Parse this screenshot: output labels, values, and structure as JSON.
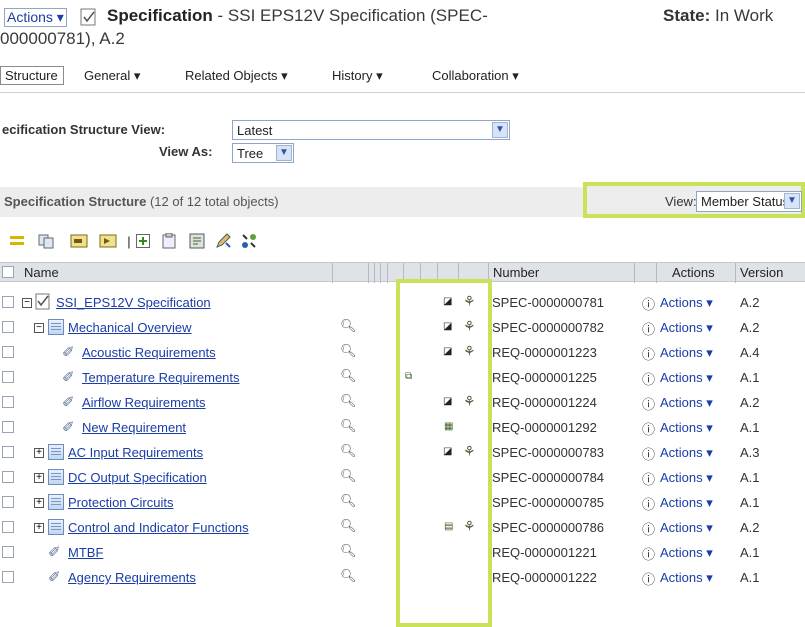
{
  "header": {
    "actions_label": "Actions",
    "object_type": "Specification",
    "title_rest": " - SSI EPS12V Specification (SPEC-",
    "title_line2": "000000781), A.2",
    "state_label": "State:",
    "state_value": "In Work"
  },
  "tabs": [
    {
      "label": "Structure"
    },
    {
      "label": "General"
    },
    {
      "label": "Related Objects"
    },
    {
      "label": "History"
    },
    {
      "label": "Collaboration"
    }
  ],
  "view": {
    "structure_view_label": "ecification Structure View:",
    "structure_view_value": "Latest",
    "view_as_label": "View As:",
    "view_as_value": "Tree"
  },
  "section": {
    "title": "Specification Structure",
    "count": "(12 of 12 total objects)",
    "view_label": "View:",
    "view_value": "Member Status"
  },
  "table": {
    "columns": [
      "Name",
      "Number",
      "Actions",
      "Version"
    ],
    "rows": [
      {
        "name": "SSI_EPS12V Specification",
        "number": "SPEC-0000000781",
        "actions": "Actions",
        "version": "A.2"
      },
      {
        "name": "Mechanical Overview",
        "number": "SPEC-0000000782",
        "actions": "Actions",
        "version": "A.2"
      },
      {
        "name": "Acoustic Requirements",
        "number": "REQ-0000001223",
        "actions": "Actions",
        "version": "A.4"
      },
      {
        "name": "Temperature Requirements",
        "number": "REQ-0000001225",
        "actions": "Actions",
        "version": "A.1"
      },
      {
        "name": "Airflow Requirements",
        "number": "REQ-0000001224",
        "actions": "Actions",
        "version": "A.2"
      },
      {
        "name": "New Requirement",
        "number": "REQ-0000001292",
        "actions": "Actions",
        "version": "A.1"
      },
      {
        "name": "AC Input Requirements",
        "number": "SPEC-0000000783",
        "actions": "Actions",
        "version": "A.3"
      },
      {
        "name": "DC Output Specification",
        "number": "SPEC-0000000784",
        "actions": "Actions",
        "version": "A.1"
      },
      {
        "name": "Protection Circuits",
        "number": "SPEC-0000000785",
        "actions": "Actions",
        "version": "A.1"
      },
      {
        "name": "Control and Indicator Functions",
        "number": "SPEC-0000000786",
        "actions": "Actions",
        "version": "A.2"
      },
      {
        "name": "MTBF",
        "number": "REQ-0000001221",
        "actions": "Actions",
        "version": "A.1"
      },
      {
        "name": "Agency Requirements",
        "number": "REQ-0000001222",
        "actions": "Actions",
        "version": "A.1"
      }
    ]
  },
  "colors": {
    "highlight": "#c8e25a",
    "link": "#1a3da8",
    "header_bg": "#ededed"
  }
}
